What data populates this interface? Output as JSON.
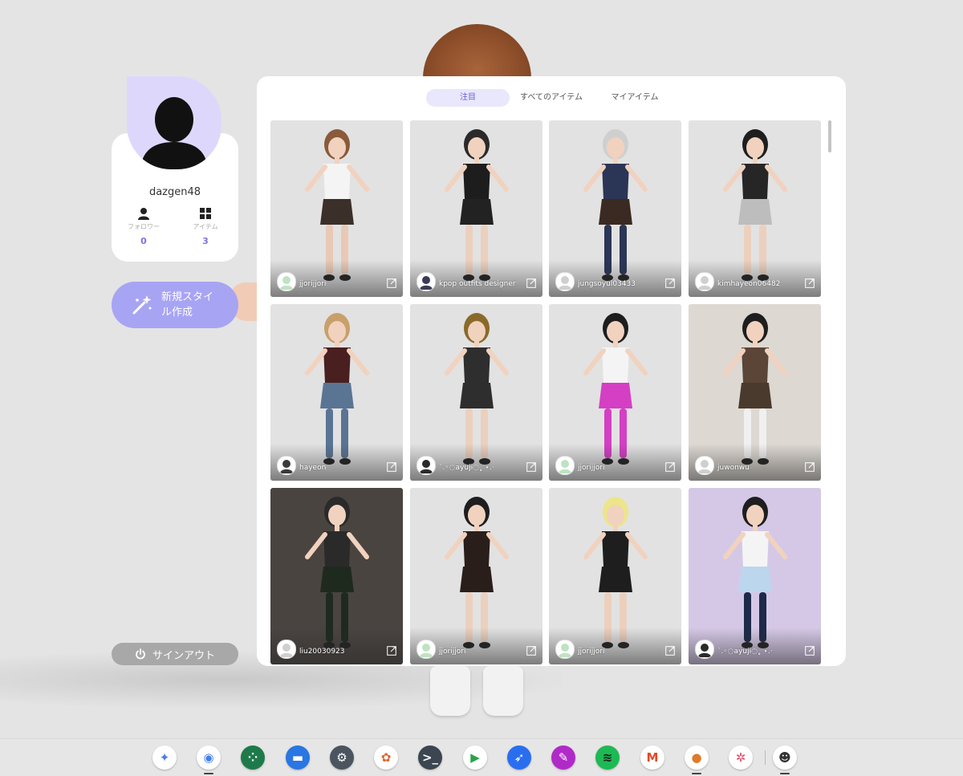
{
  "profile": {
    "username": "dazgen48",
    "follower_label": "フォロワー",
    "follower_count": "0",
    "items_label": "アイテム",
    "items_count": "3",
    "new_style_label": "新規スタイル作成",
    "signout_label": "サインアウト"
  },
  "tabs": [
    {
      "label": "注目",
      "active": true
    },
    {
      "label": "すべてのアイテム",
      "active": false
    },
    {
      "label": "マイアイテム",
      "active": false
    }
  ],
  "cards": [
    {
      "user": "jjorijjori",
      "bg": "#e2e2e2",
      "avatar_color": "#bfe3c2",
      "hair": "#8a5a3a",
      "top": "#f4f4f4",
      "bottom": "#3b2f2a",
      "legs": "#e9c9b5"
    },
    {
      "user": "kpop outfits designer",
      "bg": "#e2e2e2",
      "avatar_color": "#3a3a5a",
      "hair": "#2a2a2a",
      "top": "#1d1d1d",
      "bottom": "#222222",
      "legs": "#ecd0bd"
    },
    {
      "user": "jungsoyul03433",
      "bg": "#e2e2e2",
      "avatar_color": "#cfcfcf",
      "hair": "#cfcfcf",
      "top": "#2b3556",
      "bottom": "#3a2a22",
      "legs": "#2b3556"
    },
    {
      "user": "kimhayeon06482",
      "bg": "#e2e2e2",
      "avatar_color": "#cfcfcf",
      "hair": "#1e1e1e",
      "top": "#262626",
      "bottom": "#bdbdbd",
      "legs": "#ecd0bd"
    },
    {
      "user": "hayeon",
      "bg": "#e2e2e2",
      "avatar_color": "#3a3a3a",
      "hair": "#c9a06a",
      "top": "#4a1f1f",
      "bottom": "#5a7494",
      "legs": "#5a7494"
    },
    {
      "user": "`.◦◌ayuji◌˳ ⋆.‧",
      "bg": "#e2e2e2",
      "avatar_color": "#2a2a2a",
      "hair": "#8a6a2a",
      "top": "#2e2e2e",
      "bottom": "#2e2e2e",
      "legs": "#ecd0bd"
    },
    {
      "user": "jjorijjori",
      "bg": "#e2e2e2",
      "avatar_color": "#bfe3c2",
      "hair": "#1e1e1e",
      "top": "#f4f4f4",
      "bottom": "#d43fc4",
      "legs": "#d43fc4"
    },
    {
      "user": "juwonwu",
      "bg": "#ddd8d2",
      "avatar_color": "#cfcfcf",
      "hair": "#1e1e1e",
      "top": "#5a4536",
      "bottom": "#4a3a2e",
      "legs": "#f0f0f0"
    },
    {
      "user": "liu20030923",
      "bg": "#4a4440",
      "avatar_color": "#cfcfcf",
      "hair": "#2a2a2a",
      "top": "#2a2a2a",
      "bottom": "#1f2a1f",
      "legs": "#1f2a1f"
    },
    {
      "user": "jjorijjori",
      "bg": "#e2e2e2",
      "avatar_color": "#bfe3c2",
      "hair": "#1e1e1e",
      "top": "#2a1e1a",
      "bottom": "#2a1e1a",
      "legs": "#ecd0bd"
    },
    {
      "user": "jjorijjori",
      "bg": "#e2e2e2",
      "avatar_color": "#bfe3c2",
      "hair": "#ece58a",
      "top": "#1e1e1e",
      "bottom": "#1e1e1e",
      "legs": "#ecd0bd"
    },
    {
      "user": "`.◦◌ayuji◌˳ ⋆.‧",
      "bg": "#d5c8e6",
      "avatar_color": "#2a2a2a",
      "hair": "#1e1e1e",
      "top": "#f4f4f4",
      "bottom": "#bcd6ee",
      "legs": "#1e2a4a"
    }
  ],
  "shelf": [
    {
      "name": "gemini-icon",
      "color": "#ffffff",
      "glyph": "✦",
      "fg": "#4a7af0"
    },
    {
      "name": "chrome-icon",
      "color": "#ffffff",
      "glyph": "◉",
      "fg": "#3f7ff0"
    },
    {
      "name": "apps-icon",
      "color": "#1e7a4a",
      "glyph": "⁘",
      "fg": "#ffffff"
    },
    {
      "name": "files-icon",
      "color": "#2a76e2",
      "glyph": "▬",
      "fg": "#ffffff"
    },
    {
      "name": "settings-icon",
      "color": "#4a5560",
      "glyph": "⚙",
      "fg": "#ffffff"
    },
    {
      "name": "photos-icon",
      "color": "#ffffff",
      "glyph": "✿",
      "fg": "#e0642a"
    },
    {
      "name": "terminal-icon",
      "color": "#3c4650",
      "glyph": ">_",
      "fg": "#ffffff"
    },
    {
      "name": "play-store-icon",
      "color": "#ffffff",
      "glyph": "▶",
      "fg": "#2aa24a"
    },
    {
      "name": "rocket-icon",
      "color": "#2a6ef0",
      "glyph": "➶",
      "fg": "#ffffff"
    },
    {
      "name": "canvas-icon",
      "color": "#b02ac8",
      "glyph": "✎",
      "fg": "#ffffff"
    },
    {
      "name": "spotify-icon",
      "color": "#1db954",
      "glyph": "≋",
      "fg": "#1e1e1e"
    },
    {
      "name": "m-app-icon",
      "color": "#ffffff",
      "glyph": "M",
      "fg": "#e04a2a"
    },
    {
      "name": "avatar-app-icon",
      "color": "#ffffff",
      "glyph": "●",
      "fg": "#e07a2a"
    },
    {
      "name": "pinwheel-icon",
      "color": "#ffffff",
      "glyph": "✲",
      "fg": "#e04a6a"
    },
    {
      "name": "linux-icon",
      "color": "#ffffff",
      "glyph": "☻",
      "fg": "#333333"
    }
  ]
}
